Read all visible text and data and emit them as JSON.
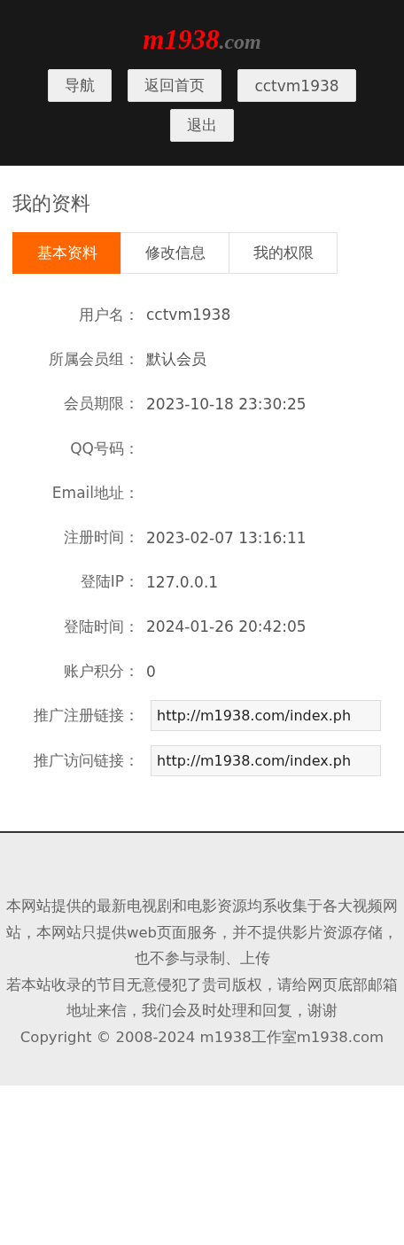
{
  "header": {
    "logo": {
      "name": "m1938",
      "domain": ".com"
    },
    "nav_buttons": [
      "导航",
      "返回首页",
      "cctvm1938",
      "退出"
    ]
  },
  "page_title": "我的资料",
  "tabs": [
    {
      "label": "基本资料",
      "selected": true
    },
    {
      "label": "修改信息",
      "selected": false
    },
    {
      "label": "我的权限",
      "selected": false
    }
  ],
  "profile_rows": [
    {
      "kind": "text",
      "label": "用户名：",
      "value": "cctvm1938"
    },
    {
      "kind": "text",
      "label": "所属会员组：",
      "value": "默认会员"
    },
    {
      "kind": "text",
      "label": "会员期限：",
      "value": "2023-10-18 23:30:25"
    },
    {
      "kind": "text",
      "label": "QQ号码："
    },
    {
      "kind": "text",
      "label": "Email地址："
    },
    {
      "kind": "text",
      "label": "注册时间：",
      "value": "2023-02-07 13:16:11"
    },
    {
      "kind": "text",
      "label": "登陆IP：",
      "value": "127.0.0.1"
    },
    {
      "kind": "text",
      "label": "登陆时间：",
      "value": "2024-01-26 20:42:05"
    },
    {
      "kind": "text",
      "label": "账户积分：",
      "value": "0"
    },
    {
      "kind": "field",
      "label": "推广注册链接：",
      "value": "http://m1938.com/index.ph"
    },
    {
      "kind": "field",
      "label": "推广访问链接：",
      "value": "http://m1938.com/index.ph"
    }
  ],
  "footer": {
    "notices": [
      "本网站提供的最新电视剧和电影资源均系收集于各大视频网站，本网站只提供web页面服务，并不提供影片资源存储，也不参与录制、上传",
      "若本站收录的节目无意侵犯了贵司版权，请给网页底部邮箱地址来信，我们会及时处理和回复，谢谢"
    ],
    "copyright": "Copyright © 2008-2024 m1938工作室m1938.com"
  }
}
